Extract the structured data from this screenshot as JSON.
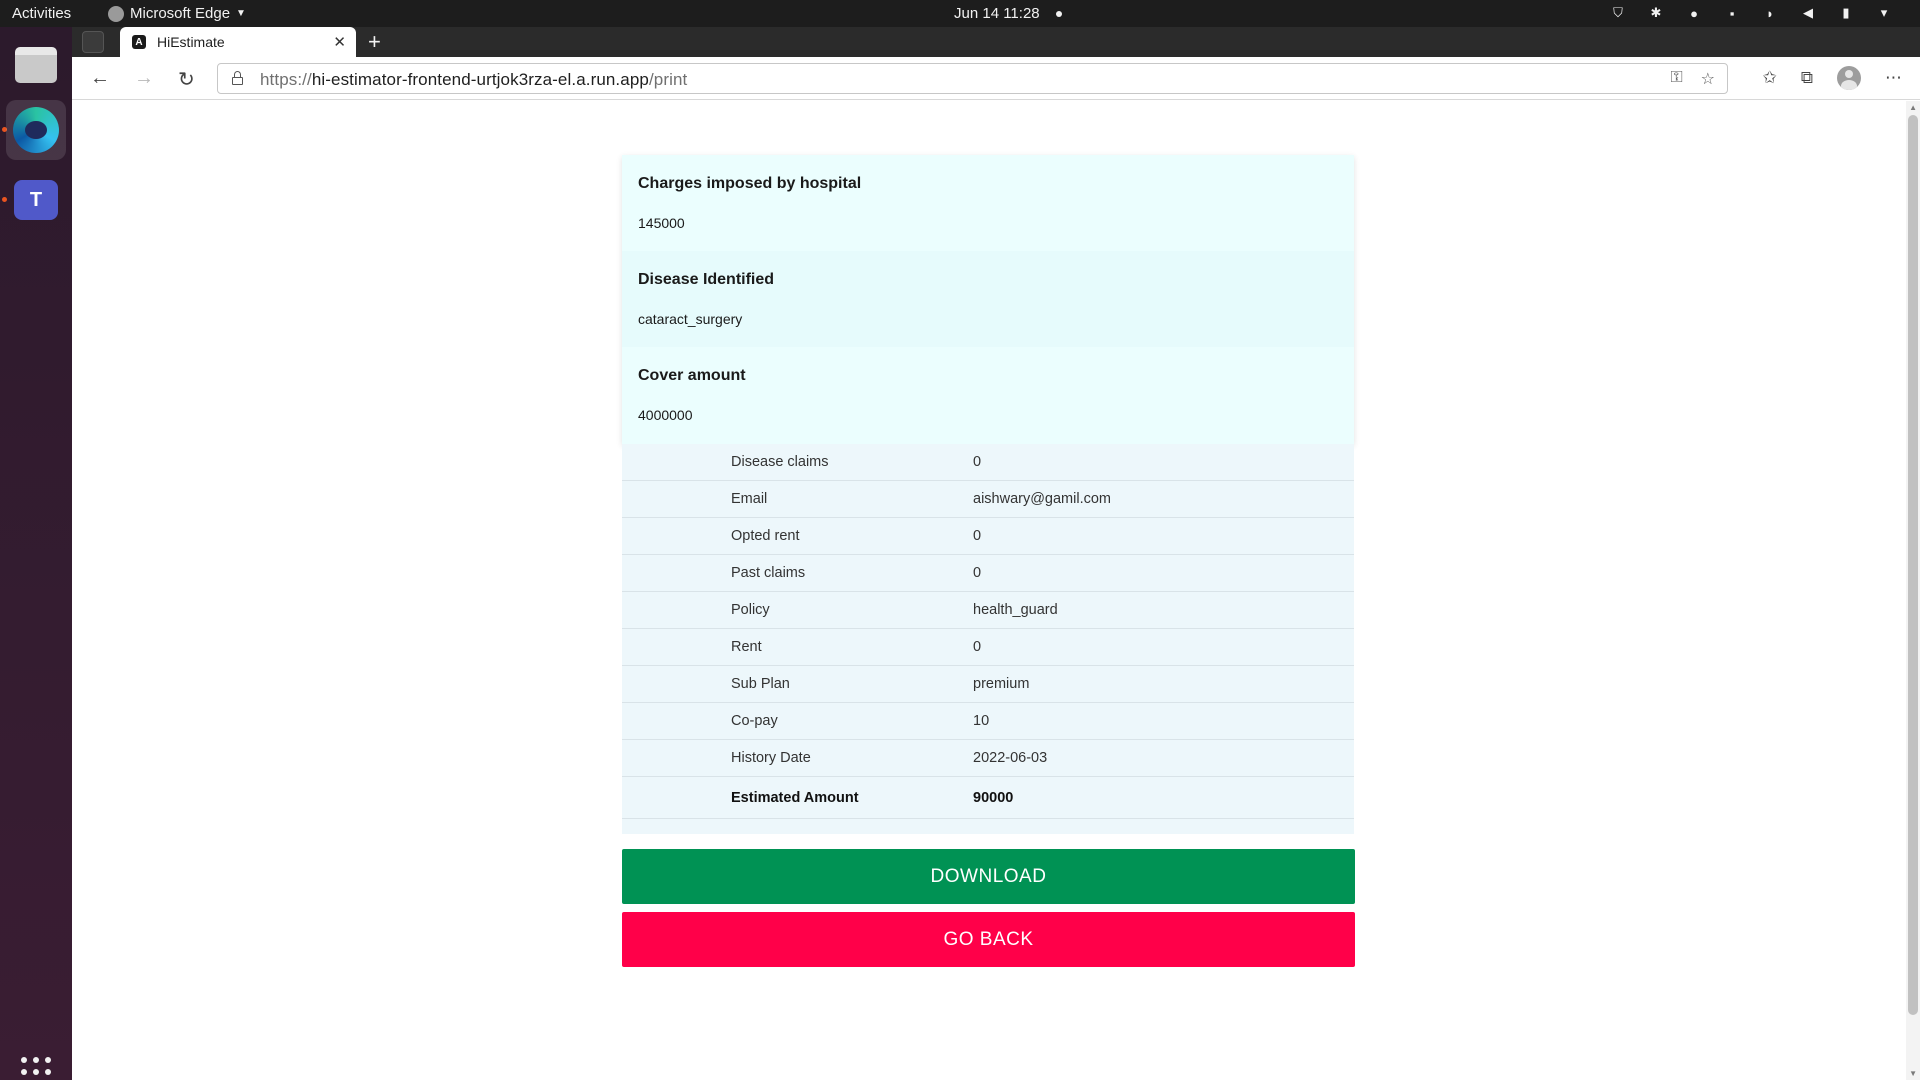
{
  "system": {
    "activities": "Activities",
    "app_name": "Microsoft Edge",
    "clock": "Jun 14  11:28"
  },
  "browser": {
    "tab_title": "HiEstimate",
    "url_scheme": "https://",
    "url_host": "hi-estimator-frontend-urtjok3rza-el.a.run.app",
    "url_path": "/print"
  },
  "summary": [
    {
      "label": "Charges imposed by hospital",
      "value": "145000"
    },
    {
      "label": "Disease Identified",
      "value": "cataract_surgery"
    },
    {
      "label": "Cover amount",
      "value": "4000000"
    }
  ],
  "details": [
    {
      "key": "Disease claims",
      "value": "0"
    },
    {
      "key": "Email",
      "value": "aishwary@gamil.com"
    },
    {
      "key": "Opted rent",
      "value": "0"
    },
    {
      "key": "Past claims",
      "value": "0"
    },
    {
      "key": "Policy",
      "value": "health_guard"
    },
    {
      "key": "Rent",
      "value": "0"
    },
    {
      "key": "Sub Plan",
      "value": "premium"
    },
    {
      "key": "Co-pay",
      "value": "10"
    },
    {
      "key": "History Date",
      "value": "2022-06-03"
    }
  ],
  "estimate": {
    "key": "Estimated Amount",
    "value": "90000"
  },
  "actions": {
    "download": "DOWNLOAD",
    "go_back": "GO BACK"
  },
  "colors": {
    "download": "#009254",
    "go_back": "#ff0049",
    "card": "#ebfefe",
    "table": "#edf7fb"
  }
}
